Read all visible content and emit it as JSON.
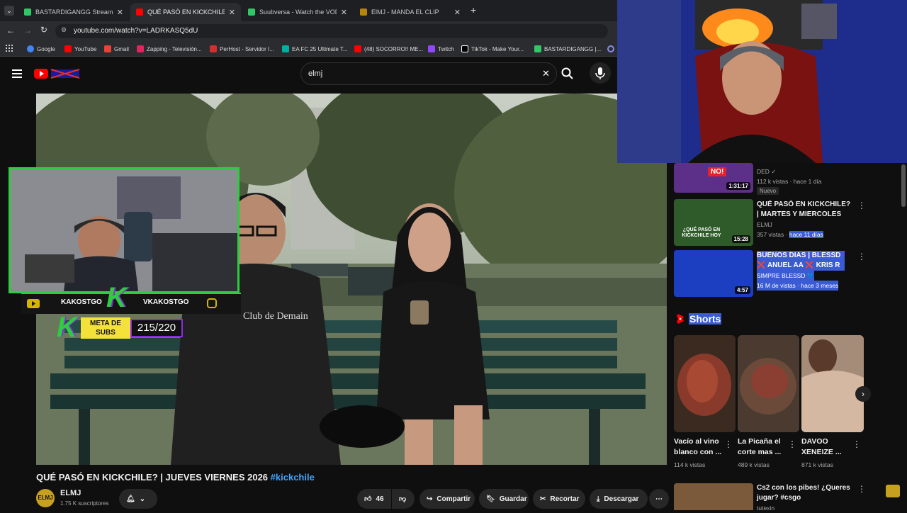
{
  "browser": {
    "tabs": [
      {
        "title": "BASTARDIGANGG Stream - Wa",
        "favicon_color": "#2ec866",
        "active": false
      },
      {
        "title": "QUÉ PASÓ EN KICKCHILE? | JUE",
        "favicon_color": "#ff0000",
        "active": true
      },
      {
        "title": "Suubversa - Watch the VOD",
        "favicon_color": "#2ec866",
        "active": false
      },
      {
        "title": "ElMJ - MANDA EL CLIP",
        "favicon_color": "#b8860b",
        "active": false
      }
    ],
    "url": "youtube.com/watch?v=LADRKASQ5dU",
    "bookmarks": [
      {
        "label": "Google",
        "color": "#4285f4"
      },
      {
        "label": "YouTube",
        "color": "#ff0000"
      },
      {
        "label": "Gmail",
        "color": "#ea4335"
      },
      {
        "label": "Zapping - Televisión...",
        "color": "#e0245e"
      },
      {
        "label": "PerHost - Servidor I...",
        "color": "#d32f2f"
      },
      {
        "label": "EA FC 25 Ultimate T...",
        "color": "#00b0a0"
      },
      {
        "label": "(48) SOCORRO!! ME...",
        "color": "#ff0000"
      },
      {
        "label": "Twitch",
        "color": "#9146ff"
      },
      {
        "label": "TikTok - Make Your...",
        "color": "#ffffff"
      },
      {
        "label": "BASTARDIGANGG |...",
        "color": "#2ec866"
      }
    ]
  },
  "search": {
    "query": "elmj"
  },
  "overlay": {
    "left_name": "KAKOSTGO",
    "right_name": "VKAKOSTGO",
    "meta_label_1": "META DE",
    "meta_label_2": "SUBS",
    "meta_count": "215/220",
    "tshirt_text": "Club de Demain"
  },
  "video": {
    "title": "QUÉ PASÓ EN KICKCHILE? | JUEVES VIERNES 2026",
    "hashtag": "#kickchile",
    "channel": "ELMJ",
    "subscribers": "1.75 K suscriptores",
    "likes": "46",
    "actions": {
      "share": "Compartir",
      "save": "Guardar",
      "clip": "Recortar",
      "download": "Descargar"
    }
  },
  "sidebar": {
    "partial_item": {
      "channel": "DED",
      "meta": "112 k vistas · hace 1 día",
      "badge": "Nuevo",
      "duration": "1:31:17",
      "thumb_text": "NO!"
    },
    "items": [
      {
        "title": "QUÉ PASÓ EN KICKCHILE? | MARTES Y MIERCOLES 2026 ...",
        "channel": "ELMJ",
        "views": "357 vistas",
        "age": "hace 11 días",
        "duration": "15:28",
        "thumb_text": "¿QUÉ PASÓ EN KICKCHILE HOY"
      },
      {
        "title": "BUENOS DIAS | BLESSD ❌ ANUEL AA ❌ KRIS R ❌ ...",
        "channel": "SIMPRE BLESSD 💙",
        "views": "16 M de vistas",
        "age": "hace 3 meses",
        "duration": "4:57"
      }
    ],
    "shorts_label": "Shorts",
    "shorts": [
      {
        "title": "Vacío al vino blanco con ...",
        "views": "114 k vistas"
      },
      {
        "title": "La Picaña el corte mas ...",
        "views": "489 k vistas"
      },
      {
        "title": "DAVOO XENEIZE ...",
        "views": "871 k vistas"
      }
    ],
    "bottom_item": {
      "title": "Cs2 con los pibes! ¿Queres jugar? #csgo",
      "channel": "tutexin"
    }
  },
  "colors": {
    "accent_red": "#ff0000",
    "highlight": "#3a5bd4",
    "overlay_green": "#2ecc40",
    "overlay_purple": "#8a2be2"
  }
}
